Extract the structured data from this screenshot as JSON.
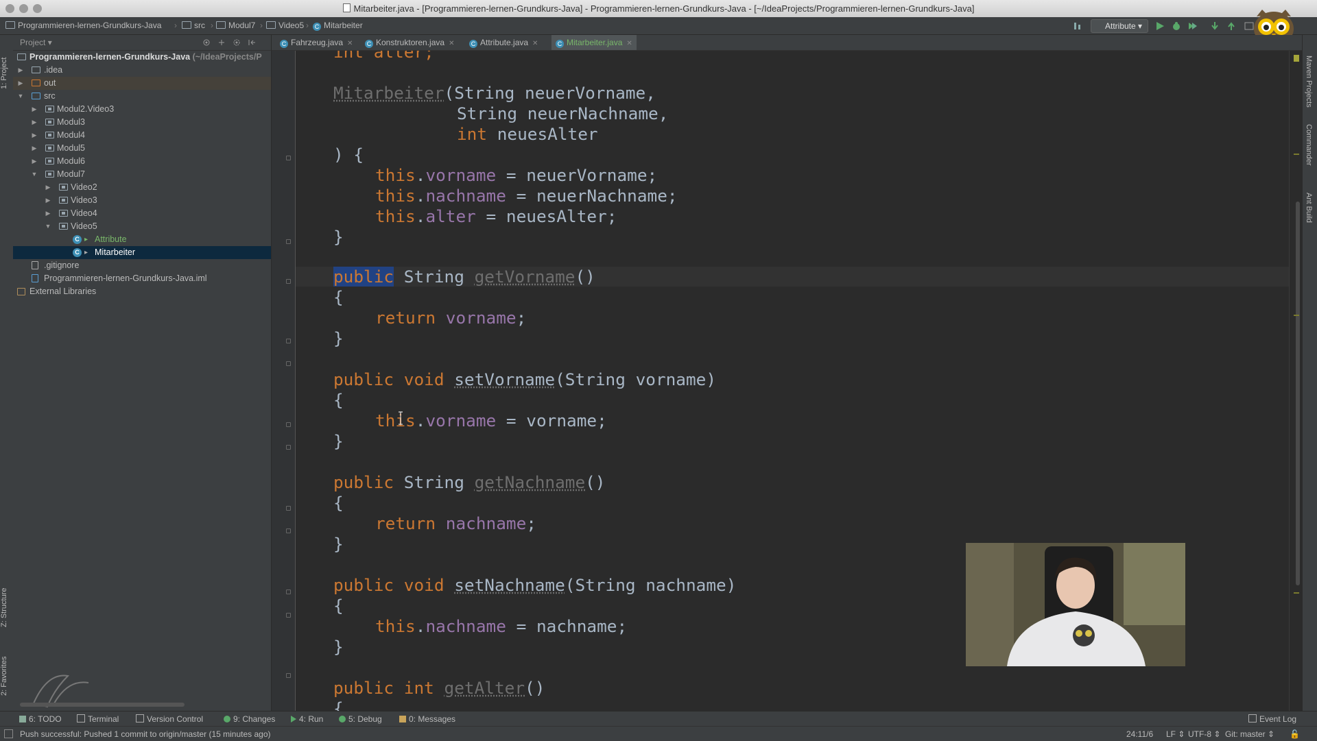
{
  "window": {
    "title": "Mitarbeiter.java - [Programmieren-lernen-Grundkurs-Java] - Programmieren-lernen-Grundkurs-Java - [~/IdeaProjects/Programmieren-lernen-Grundkurs-Java]"
  },
  "navbar": {
    "crumbs": [
      "Programmieren-lernen-Grundkurs-Java",
      "src",
      "Modul7",
      "Video5",
      "Mitarbeiter"
    ],
    "run_config": "Attribute"
  },
  "left_strip": {
    "project_tab": "1: Project",
    "structure_tab": "Z: Structure",
    "favorites_tab": "2: Favorites"
  },
  "right_strip": {
    "maven_tab": "Maven Projects",
    "commander_tab": "Commander",
    "ant_tab": "Ant Build"
  },
  "project": {
    "header": "Project",
    "tree": [
      {
        "label": "Programmieren-lernen-Grundkurs-Java",
        "suffix": "(~/IdeaProjects/P"
      },
      {
        "label": ".idea"
      },
      {
        "label": "out"
      },
      {
        "label": "src"
      },
      {
        "label": "Modul2.Video3"
      },
      {
        "label": "Modul3"
      },
      {
        "label": "Modul4"
      },
      {
        "label": "Modul5"
      },
      {
        "label": "Modul6"
      },
      {
        "label": "Modul7"
      },
      {
        "label": "Video2"
      },
      {
        "label": "Video3"
      },
      {
        "label": "Video4"
      },
      {
        "label": "Video5"
      },
      {
        "label": "Attribute"
      },
      {
        "label": "Mitarbeiter"
      },
      {
        "label": ".gitignore"
      },
      {
        "label": "Programmieren-lernen-Grundkurs-Java.iml"
      },
      {
        "label": "External Libraries"
      }
    ]
  },
  "editor": {
    "tabs": [
      {
        "label": "Fahrzeug.java"
      },
      {
        "label": "Konstruktoren.java"
      },
      {
        "label": "Attribute.java"
      },
      {
        "label": "Mitarbeiter.java"
      }
    ],
    "code": {
      "l0": "int alter;",
      "l1_name": "Mitarbeiter",
      "l1_rest": "(String neuerVorname,",
      "l2": "String neuerNachname,",
      "l3_kw": "int",
      "l3_rest": " neuesAlter",
      "l4": ") {",
      "this": "this",
      "vorname": "vorname",
      "nachname": "nachname",
      "alter": "alter",
      "l5_rest": " = neuerVorname;",
      "l6_rest": " = neuerNachname;",
      "l7_rest": " = neuesAlter;",
      "close": "}",
      "open": "{",
      "public": "public",
      "void": "void",
      "return": "return",
      "int_kw": "int",
      "string_type": " String ",
      "getVorname": "getVorname",
      "setVorname": "setVorname",
      "getNachname": "getNachname",
      "setNachname": "setNachname",
      "getAlter": "getAlter",
      "parens": "()",
      "setVorname_params": "(String vorname)",
      "setNachname_params": "(String nachname)",
      "semi": ";",
      "assign_vorname": " = vorname;",
      "assign_nachname": " = nachname;"
    }
  },
  "toolwindows": {
    "todo": "6: TODO",
    "terminal": "Terminal",
    "vcs": "Version Control",
    "changes": "9: Changes",
    "run": "4: Run",
    "debug": "5: Debug",
    "messages": "0: Messages",
    "event_log": "Event Log"
  },
  "status": {
    "message": "Push successful: Pushed 1 commit to origin/master (15 minutes ago)",
    "position": "24:11/6",
    "line_sep": "LF",
    "encoding": "UTF-8",
    "vcs": "Git: master"
  },
  "colors": {
    "keyword": "#cc7832",
    "field": "#9876aa",
    "text": "#a9b7c6",
    "background": "#2b2b2b",
    "selection": "#214283"
  }
}
